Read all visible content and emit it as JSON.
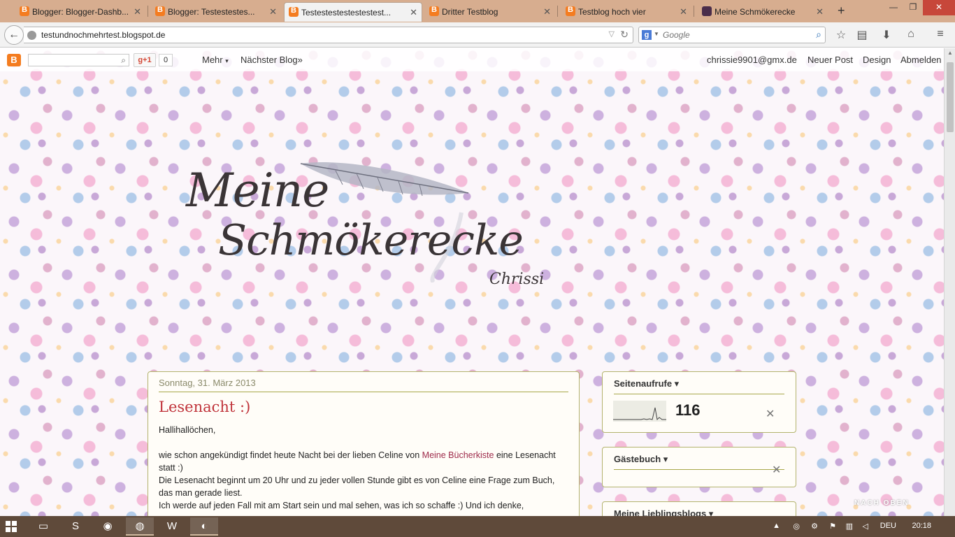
{
  "browser": {
    "tabs": [
      {
        "label": "Blogger: Blogger-Dashb...",
        "favicon": "blogger-icon",
        "active": false
      },
      {
        "label": "Blogger: Testestestes...",
        "favicon": "blogger-icon",
        "active": false
      },
      {
        "label": "Testestestestestestest...",
        "favicon": "blogger-icon",
        "active": true
      },
      {
        "label": "Dritter Testblog",
        "favicon": "blogger-icon",
        "active": false
      },
      {
        "label": "Testblog hoch vier",
        "favicon": "blogger-icon",
        "active": false
      },
      {
        "label": "Meine Schmökerecke",
        "favicon": "book-icon",
        "active": false
      }
    ],
    "tab_close_glyph": "✕",
    "new_tab_glyph": "+",
    "window_controls": {
      "minimize": "—",
      "maximize": "❐",
      "close": "✕"
    },
    "url": "testundnochmehrtest.blogspot.de",
    "search": {
      "engine_letter": "g",
      "placeholder": "Google"
    }
  },
  "blogger_navbar": {
    "gplus_label": "g+1",
    "gplus_count": "0",
    "more_label": "Mehr",
    "next_blog_label": "Nächster Blog»",
    "user_email": "chrissie9901@gmx.de",
    "new_post_label": "Neuer Post",
    "design_label": "Design",
    "logout_label": "Abmelden"
  },
  "header": {
    "title_line1": "Meine",
    "title_line2": "Schmökerecke",
    "signature": "Chrissi"
  },
  "post": {
    "date": "Sonntag, 31. März 2013",
    "title": "Lesenacht :)",
    "greeting": "Hallihallöchen,",
    "line1_before": "wie schon angekündigt findet heute Nacht bei der lieben Celine von ",
    "line1_link": "Meine Bücherkiste",
    "line1_after": " eine Lesenacht statt :)",
    "line2": "Die Lesenacht beginnt um 20 Uhr und zu jeder vollen Stunde gibt es von Celine eine Frage zum Buch, das man gerade liest.",
    "line3": "Ich werde auf jeden Fall mit am Start sein und mal sehen, was ich so schaffe :) Und ich denke,"
  },
  "sidebar": {
    "pageviews_title": "Seitenaufrufe ▾",
    "pageviews_count": "116",
    "guestbook_title": "Gästebuch ▾",
    "favorites_title": "Meine Lieblingsblogs ▾"
  },
  "back_to_top": "NACH OBEN",
  "taskbar": {
    "language": "DEU",
    "time": "20:18"
  },
  "colors": {
    "tabstrip": "#d7ad8f",
    "post_title": "#c0343b",
    "widget_border": "#b3b36d",
    "taskbar": "#5f4a3a"
  }
}
